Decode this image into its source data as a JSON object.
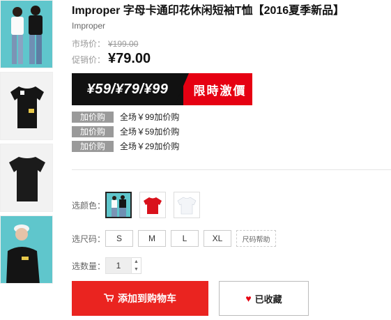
{
  "product": {
    "title": "Improper 字母卡通印花休闲短袖T恤【2016夏季新品】",
    "brand": "Improper",
    "market_label": "市场价：",
    "market_price": "¥199.00",
    "promo_label": "促销价：",
    "promo_price": "¥79.00"
  },
  "banner": {
    "prices": "¥59/¥79/¥99",
    "slogan": "限時激價",
    "colors": {
      "dark": "#111111",
      "red": "#e60012"
    }
  },
  "addons": [
    {
      "tag": "加价购",
      "text": "全场￥99加价购"
    },
    {
      "tag": "加价购",
      "text": "全场￥59加价购"
    },
    {
      "tag": "加价购",
      "text": "全场￥29加价购"
    }
  ],
  "options": {
    "color_label": "选颜色：",
    "colors": [
      "model-photo",
      "red-tshirt",
      "white-tshirt"
    ],
    "selected_color_index": 0,
    "size_label": "选尺码：",
    "sizes": [
      "S",
      "M",
      "L",
      "XL"
    ],
    "size_help": "尺码帮助",
    "qty_label": "选数量：",
    "quantity": "1"
  },
  "actions": {
    "add_to_cart": "添加到购物车",
    "favorited": "已收藏",
    "accent": "#ea2420"
  },
  "thumbnails": [
    "couple-photo",
    "black-tshirt-front",
    "black-tshirt-back",
    "model-wearing-tshirt"
  ]
}
